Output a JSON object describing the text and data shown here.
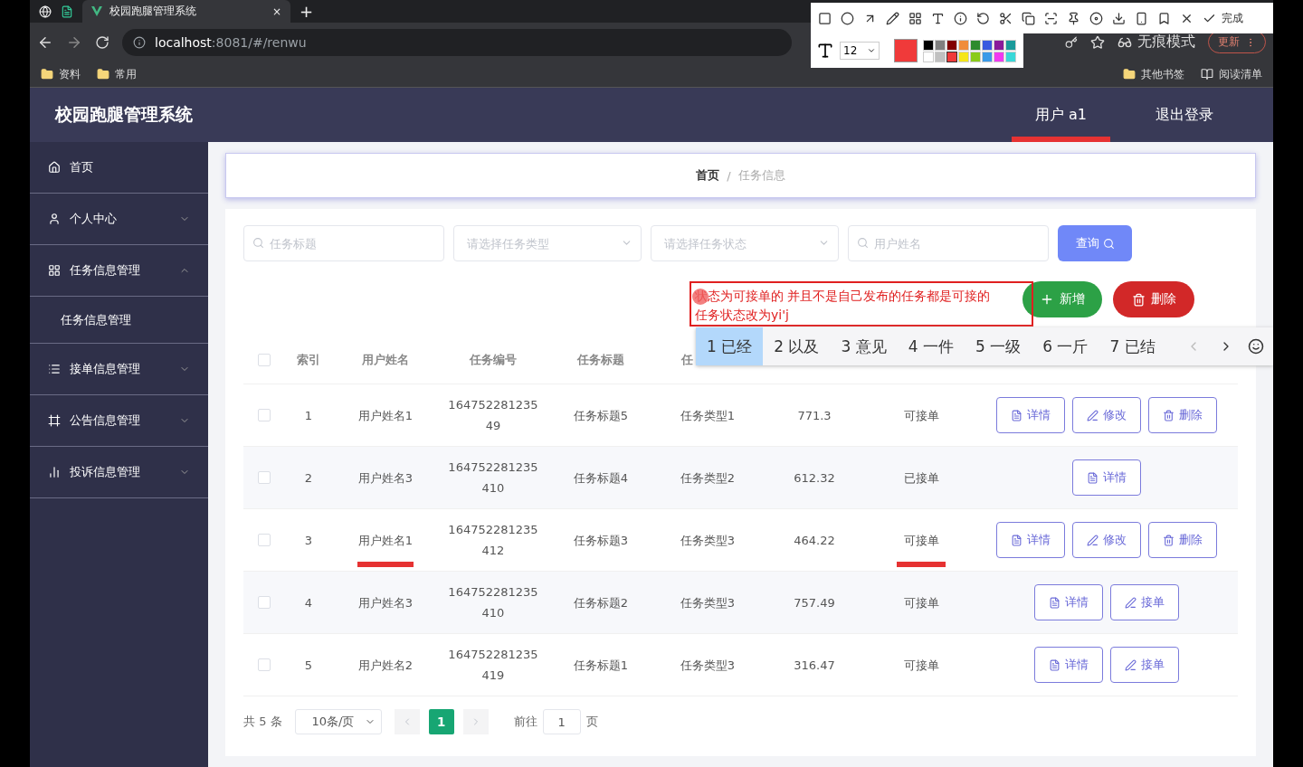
{
  "browser": {
    "tab_title": "校园跑腿管理系统",
    "tab_close": "×",
    "new_tab": "+",
    "address_host": "localhost",
    "address_rest": ":8081/#/renwu",
    "bookmarks": [
      "资料",
      "常用"
    ],
    "right_bookmarks": [
      "其他书签",
      "阅读清单"
    ],
    "incognito": "无痕模式",
    "update": "更新"
  },
  "capture_toolbar": {
    "done": "完成",
    "font_size": "12",
    "palette": [
      {
        "color": "#000000",
        "selected": false
      },
      {
        "color": "#808080",
        "selected": false
      },
      {
        "color": "#800000",
        "selected": false
      },
      {
        "color": "#f08c3a",
        "selected": false
      },
      {
        "color": "#2e8b2e",
        "selected": false
      },
      {
        "color": "#3a5ae0",
        "selected": false
      },
      {
        "color": "#8a1a9a",
        "selected": false
      },
      {
        "color": "#1a9a9a",
        "selected": false
      },
      {
        "color": "#ffffff",
        "selected": false
      },
      {
        "color": "#c0c0c0",
        "selected": false
      },
      {
        "color": "#f03a3a",
        "selected": true
      },
      {
        "color": "#f5e61a",
        "selected": false
      },
      {
        "color": "#8acb1a",
        "selected": false
      },
      {
        "color": "#3a9ae8",
        "selected": false
      },
      {
        "color": "#f03af0",
        "selected": false
      },
      {
        "color": "#3ad8d8",
        "selected": false
      }
    ]
  },
  "app": {
    "title": "校园跑腿管理系统",
    "header_links": [
      {
        "label": "用户 a1",
        "underlined": true
      },
      {
        "label": "退出登录",
        "underlined": false
      }
    ]
  },
  "sidebar": {
    "items": [
      {
        "label": "首页",
        "kind": "home"
      },
      {
        "label": "个人中心",
        "kind": "user",
        "expanded": false
      },
      {
        "label": "任务信息管理",
        "kind": "grid",
        "expanded": true,
        "children": [
          {
            "label": "任务信息管理"
          }
        ]
      },
      {
        "label": "接单信息管理",
        "kind": "list",
        "expanded": false
      },
      {
        "label": "公告信息管理",
        "kind": "frame",
        "expanded": false
      },
      {
        "label": "投诉信息管理",
        "kind": "bars",
        "expanded": false
      }
    ]
  },
  "breadcrumb": [
    "首页",
    "任务信息"
  ],
  "breadcrumb_separator": "/",
  "filters": [
    {
      "kind": "search",
      "placeholder": "任务标题"
    },
    {
      "kind": "select",
      "placeholder": "请选择任务类型"
    },
    {
      "kind": "select",
      "placeholder": "请选择任务状态"
    },
    {
      "kind": "search",
      "placeholder": "用户姓名"
    }
  ],
  "query_button": "查询",
  "actions": [
    {
      "kind": "add",
      "label": "新增"
    },
    {
      "kind": "delete",
      "label": "删除"
    }
  ],
  "note": {
    "lines": [
      "状态为可接单的 并且不是自己发布的任务都是可接的",
      "任务状态改为yi'j"
    ]
  },
  "ime_candidates": [
    {
      "label": "1 已经",
      "selected": true
    },
    {
      "label": "2 以及",
      "selected": false
    },
    {
      "label": "3 意见",
      "selected": false
    },
    {
      "label": "4 一件",
      "selected": false
    },
    {
      "label": "5 一级",
      "selected": false
    },
    {
      "label": "6 一斤",
      "selected": false
    },
    {
      "label": "7 已结",
      "selected": false
    }
  ],
  "table": {
    "all_checked": false,
    "columns": [
      "索引",
      "用户姓名",
      "任务编号",
      "任务标题",
      "任"
    ],
    "rows": [
      {
        "checked": false,
        "index": "1",
        "user": "用户姓名1",
        "number": [
          "164752281235",
          "49"
        ],
        "title": "任务标题5",
        "type": "任务类型1",
        "price": "771.3",
        "status": "可接单",
        "marked": false,
        "actions": [
          {
            "kind": "detail",
            "label": "详情"
          },
          {
            "kind": "edit",
            "label": "修改"
          },
          {
            "kind": "delete",
            "label": "删除"
          }
        ]
      },
      {
        "checked": false,
        "index": "2",
        "user": "用户姓名3",
        "number": [
          "164752281235",
          "410"
        ],
        "title": "任务标题4",
        "type": "任务类型2",
        "price": "612.32",
        "status": "已接单",
        "marked": false,
        "actions": [
          {
            "kind": "detail",
            "label": "详情"
          }
        ]
      },
      {
        "checked": false,
        "index": "3",
        "user": "用户姓名1",
        "number": [
          "164752281235",
          "412"
        ],
        "title": "任务标题3",
        "type": "任务类型3",
        "price": "464.22",
        "status": "可接单",
        "marked": true,
        "actions": [
          {
            "kind": "detail",
            "label": "详情"
          },
          {
            "kind": "edit",
            "label": "修改"
          },
          {
            "kind": "delete",
            "label": "删除"
          }
        ]
      },
      {
        "checked": false,
        "index": "4",
        "user": "用户姓名3",
        "number": [
          "164752281235",
          "410"
        ],
        "title": "任务标题2",
        "type": "任务类型3",
        "price": "757.49",
        "status": "可接单",
        "marked": false,
        "actions": [
          {
            "kind": "detail",
            "label": "详情"
          },
          {
            "kind": "edit",
            "label": "接单"
          }
        ]
      },
      {
        "checked": false,
        "index": "5",
        "user": "用户姓名2",
        "number": [
          "164752281235",
          "419"
        ],
        "title": "任务标题1",
        "type": "任务类型3",
        "price": "316.47",
        "status": "可接单",
        "marked": false,
        "actions": [
          {
            "kind": "detail",
            "label": "详情"
          },
          {
            "kind": "edit",
            "label": "接单"
          }
        ]
      }
    ]
  },
  "pagination": {
    "total": "共 5 条",
    "page_size": "10条/页",
    "pages": [
      {
        "label": "1",
        "selected": true
      }
    ],
    "goto": "前往",
    "goto_value": "1",
    "page_unit": "页"
  }
}
